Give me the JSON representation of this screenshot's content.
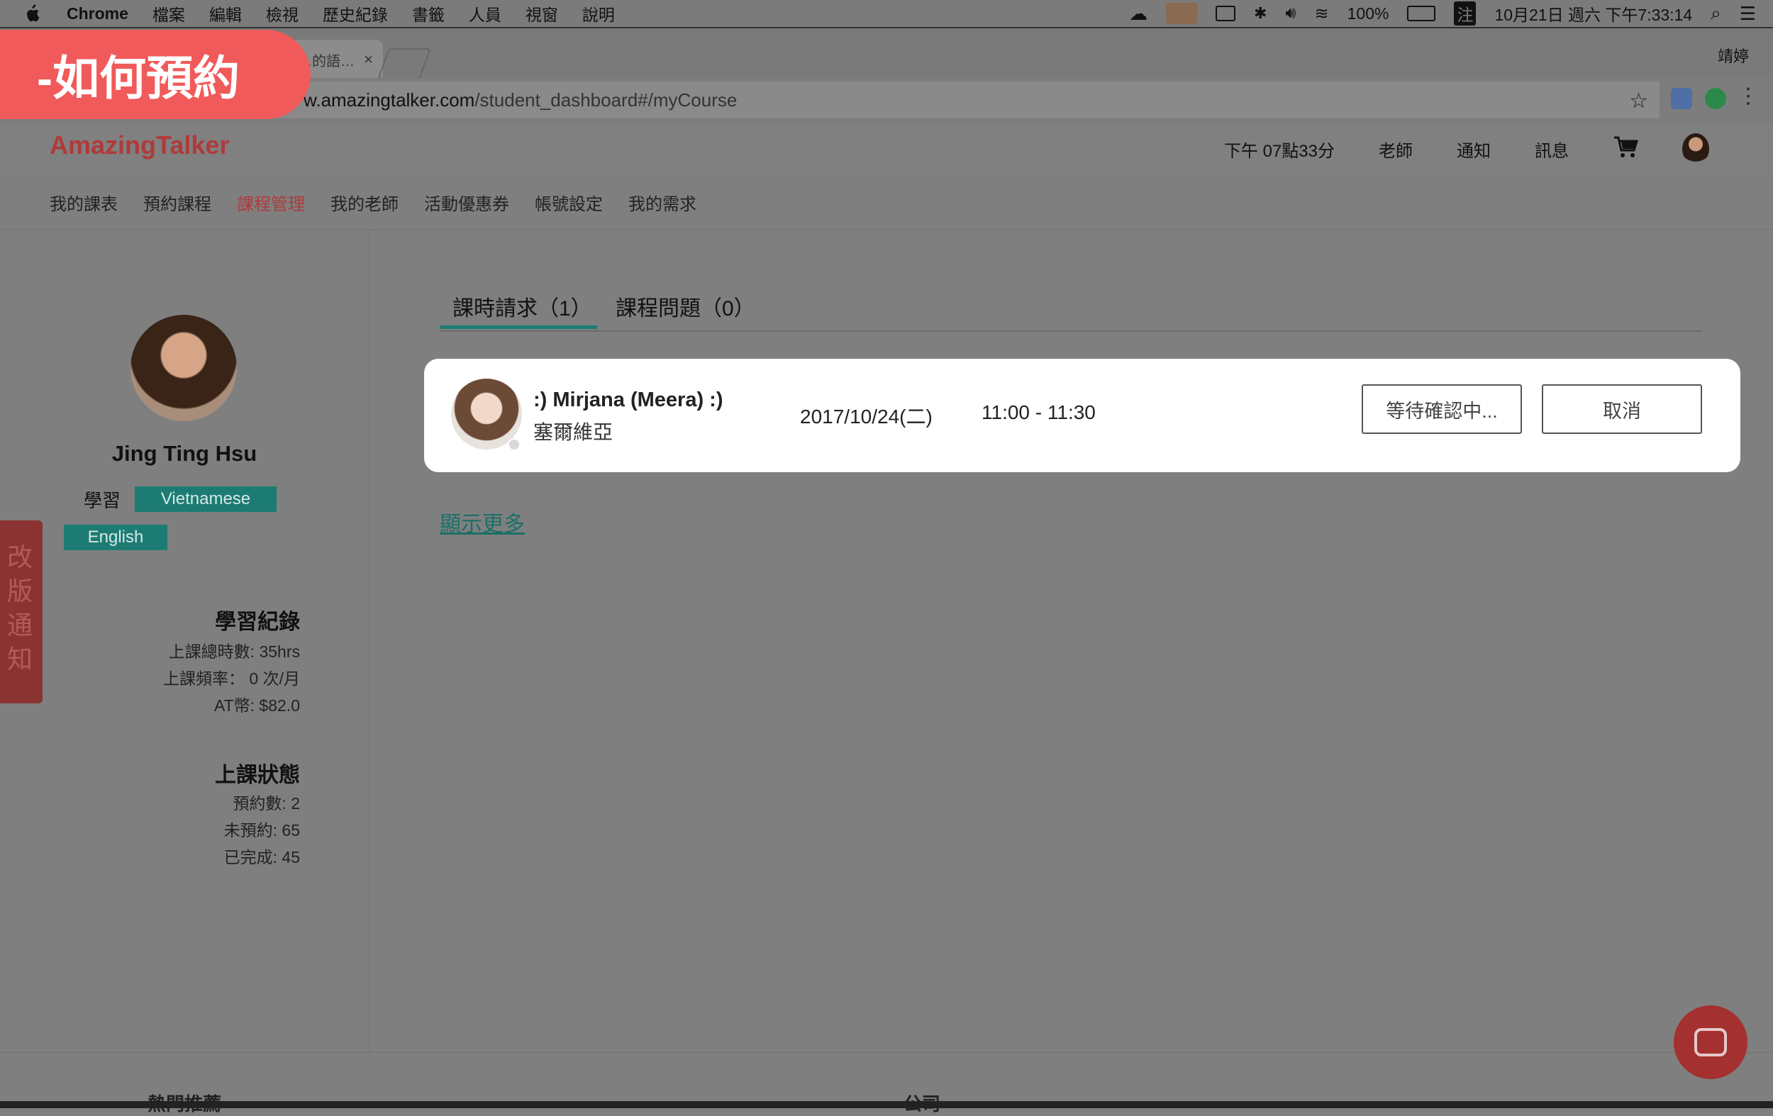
{
  "menubar": {
    "app_name": "Chrome",
    "items": [
      "檔案",
      "編輯",
      "檢視",
      "歷史紀錄",
      "書籤",
      "人員",
      "視窗",
      "說明"
    ],
    "battery": "100%",
    "input_method": "注",
    "datetime": "10月21日 週六 下午7:33:14"
  },
  "browser": {
    "tab_title": "…的語…",
    "profile_name": "靖婷",
    "url_host": "w.amazingtalker.com",
    "url_path": "/student_dashboard#/myCourse"
  },
  "site": {
    "logo": "AmazingTalker",
    "time": "下午 07點33分",
    "nav": [
      "老師",
      "通知",
      "訊息"
    ]
  },
  "subnav": [
    "我的課表",
    "預約課程",
    "課程管理",
    "我的老師",
    "活動優惠券",
    "帳號設定",
    "我的需求"
  ],
  "sidebar": {
    "name": "Jing Ting Hsu",
    "learn_label": "學習",
    "languages": [
      "Vietnamese",
      "English"
    ],
    "record_title": "學習紀錄",
    "records": [
      "上課總時數: 35hrs",
      "上課頻率： 0 次/月",
      "AT幣: $82.0"
    ],
    "status_title": "上課狀態",
    "statuses": [
      "預約數: 2",
      "未預約: 65",
      "已完成: 45"
    ],
    "notice_chars": [
      "改",
      "版",
      "通",
      "知"
    ]
  },
  "main": {
    "tabs": [
      "課時請求（1）",
      "課程問題（0）"
    ],
    "request": {
      "teacher_name": ":) Mirjana (Meera) :)",
      "country": "塞爾維亞",
      "date": "2017/10/24(二)",
      "time": "11:00 - 11:30",
      "status_button": "等待確認中...",
      "cancel_button": "取消"
    },
    "show_more": "顯示更多"
  },
  "footer": {
    "col1": "熱門推薦",
    "col2": "公司"
  },
  "overlay_label": "-如何預約"
}
